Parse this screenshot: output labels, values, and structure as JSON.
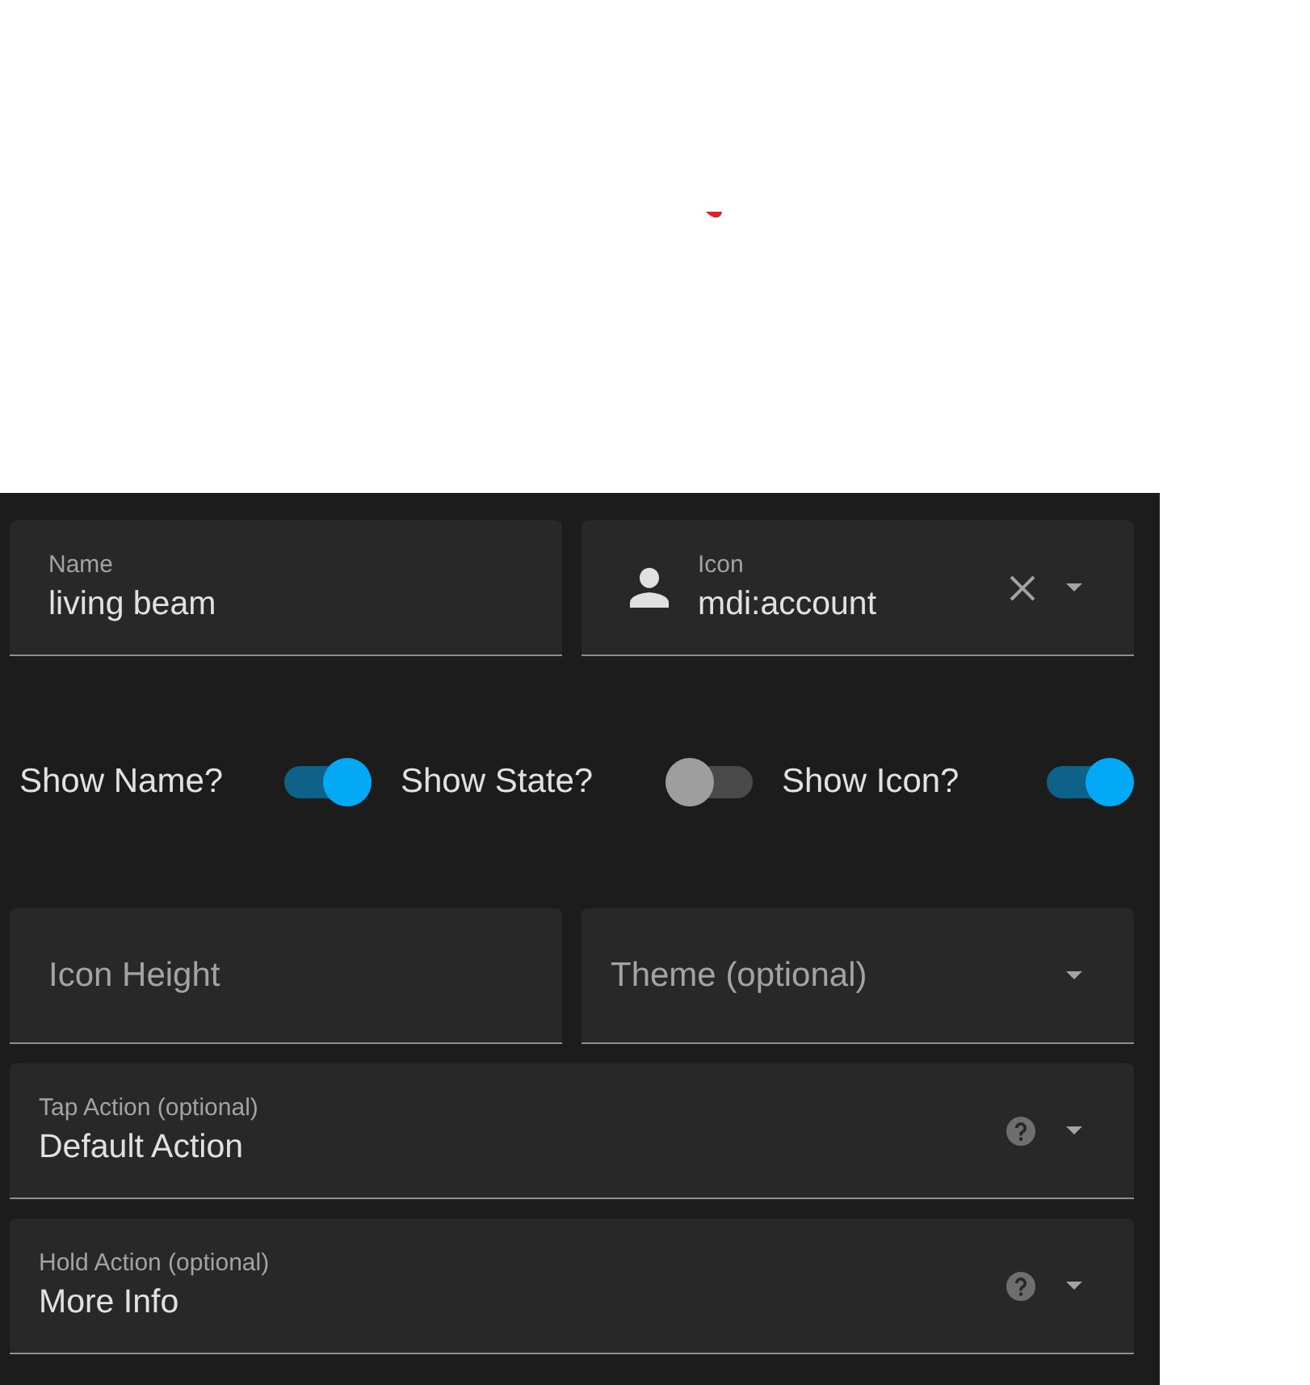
{
  "fields": [
    {
      "kind": "text",
      "label": "Name",
      "value": "living beam"
    },
    {
      "kind": "icon",
      "label": "Icon",
      "value": "mdi:account"
    }
  ],
  "toggles": [
    {
      "label": "Show Name?",
      "on": true
    },
    {
      "label": "Show State?",
      "on": false
    },
    {
      "label": "Show Icon?",
      "on": true
    }
  ],
  "options": [
    {
      "kind": "text",
      "label": "Icon Height"
    },
    {
      "kind": "select",
      "label": "Theme (optional)"
    }
  ],
  "actions": [
    {
      "kind": "action",
      "label": "Tap Action (optional)",
      "value": "Default Action"
    },
    {
      "kind": "action",
      "label": "Hold Action (optional)",
      "value": "More Info"
    }
  ]
}
